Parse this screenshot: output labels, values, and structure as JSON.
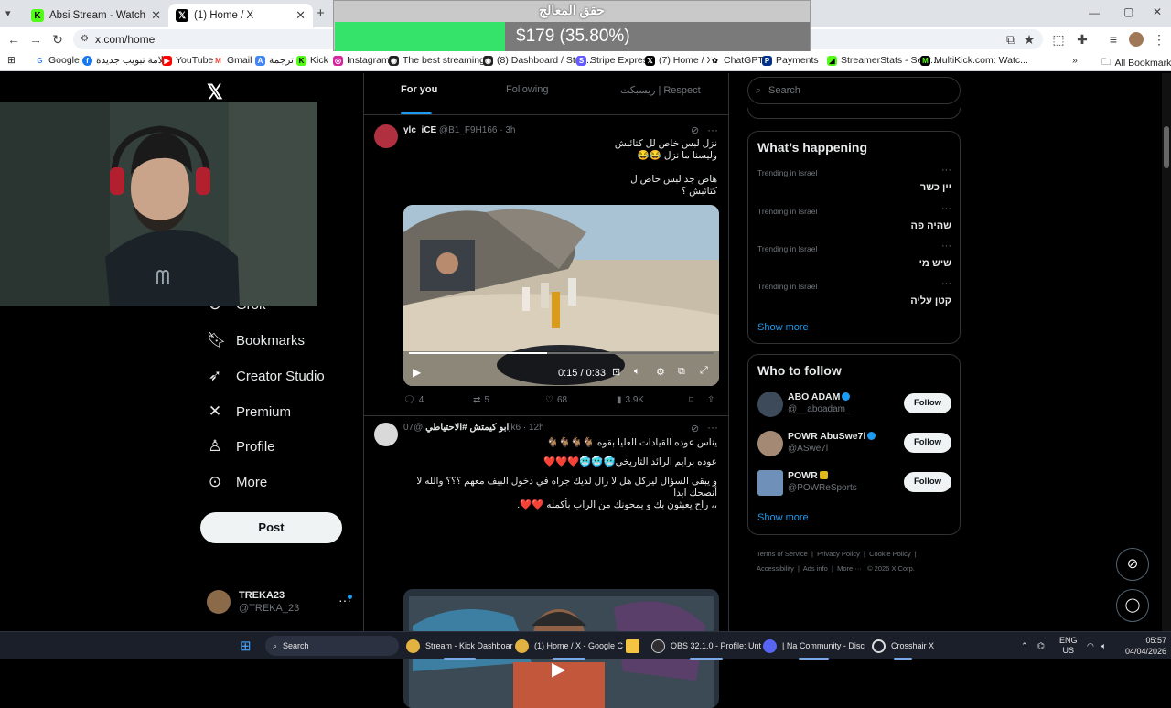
{
  "browser": {
    "tabs": [
      {
        "title": "Absi Stream - Watch Live on Ki…",
        "icon": "kick-icon"
      },
      {
        "title": "(1) Home / X",
        "icon": "x-icon"
      }
    ],
    "url": "x.com/home",
    "bookmarks": [
      "Google",
      "علامة تبويب جديدة",
      "YouTube",
      "Gmail",
      "ترجمة",
      "Kick",
      "Instagram",
      "The best streaming...",
      "(8) Dashboard / Stre...",
      "Stripe Express",
      "(7) Home / X",
      "ChatGPT",
      "Payments",
      "StreamerStats - Sear...",
      "MultiKick.com: Watc..."
    ],
    "all_bookmarks": "All Bookmarks"
  },
  "overlay": {
    "title": "حقق المعالج",
    "amount": "$179 (35.80%)",
    "progress": 0.358,
    "fill_color": "#36e36a"
  },
  "nav": {
    "items": [
      {
        "label": "Grok",
        "icon": "grok-icon"
      },
      {
        "label": "Bookmarks",
        "icon": "bookmark-icon"
      },
      {
        "label": "Creator Studio",
        "icon": "rocket-icon"
      },
      {
        "label": "Premium",
        "icon": "x-icon"
      },
      {
        "label": "Profile",
        "icon": "person-icon"
      },
      {
        "label": "More",
        "icon": "more-circle-icon"
      }
    ],
    "post": "Post",
    "account": {
      "name": "TREKA23",
      "handle": "@TREKA_23"
    }
  },
  "feed": {
    "tabs": [
      "For you",
      "Following",
      "ريسبكت | Respect"
    ],
    "tweets": [
      {
        "name": "ylc_iCE",
        "handle": "@B1_F9H166",
        "time": "· 3h",
        "lines": [
          "نزل لبس خاص لل كتائبش",
          "وليسنا ما نزل 😂😂",
          "",
          "هاض جد لبس خاص ل",
          "كتائبش ؟"
        ],
        "video_time": "0:15 / 0:33",
        "replies": "4",
        "reposts": "5",
        "likes": "68",
        "views": "3.9K"
      },
      {
        "name": "ابو كيمتش #الاحتياطي",
        "handle": "@07jk6",
        "time": "· 12h",
        "lines": [
          "يناس عوده القيادات العليا بقوه 🐐🐐🐐🐐",
          "",
          "عوده برايم الرائد التاريخي🥶🥶🥶❤️❤️❤️",
          "",
          "و يبقى السؤال ليركل هل لا زال لديك جراه في دخول البيف معهم ؟؟؟ والله لا أنصحك ابدا",
          "،، راح يعبثون بك و يمحونك من الراب بأكمله ❤️❤️."
        ]
      }
    ]
  },
  "sidebar": {
    "search_placeholder": "Search",
    "happening_title": "What’s happening",
    "trends": [
      {
        "context": "Trending in Israel",
        "name": "יין כשר"
      },
      {
        "context": "Trending in Israel",
        "name": "שהיה פה"
      },
      {
        "context": "Trending in Israel",
        "name": "שיש מי"
      },
      {
        "context": "Trending in Israel",
        "name": "קטן עליה"
      }
    ],
    "show_more": "Show more",
    "who_title": "Who to follow",
    "follow": [
      {
        "name": "ABO ADAM",
        "handle": "@__aboadam_",
        "badge": "blue"
      },
      {
        "name": "POWR AbuSwe7l",
        "handle": "@ASwe7l",
        "badge": "blue"
      },
      {
        "name": "POWR",
        "handle": "@POWReSports",
        "badge": "gold"
      }
    ],
    "follow_label": "Follow",
    "footer": [
      "Terms of Service",
      "Privacy Policy",
      "Cookie Policy",
      "Accessibility",
      "Ads info",
      "More ···",
      "© 2026 X Corp."
    ]
  },
  "taskbar": {
    "search": "Search",
    "apps": [
      "Stream - Kick Dashboar",
      "(1) Home / X - Google C",
      "OBS 32.1.0 - Profile: Unt",
      "| Na Community - Disc",
      "Crosshair X"
    ],
    "lang": "ENG",
    "region": "US",
    "time": "05:57",
    "date": "04/04/2026"
  },
  "colors": {
    "accent": "#1d9bf0",
    "background": "#000000"
  }
}
